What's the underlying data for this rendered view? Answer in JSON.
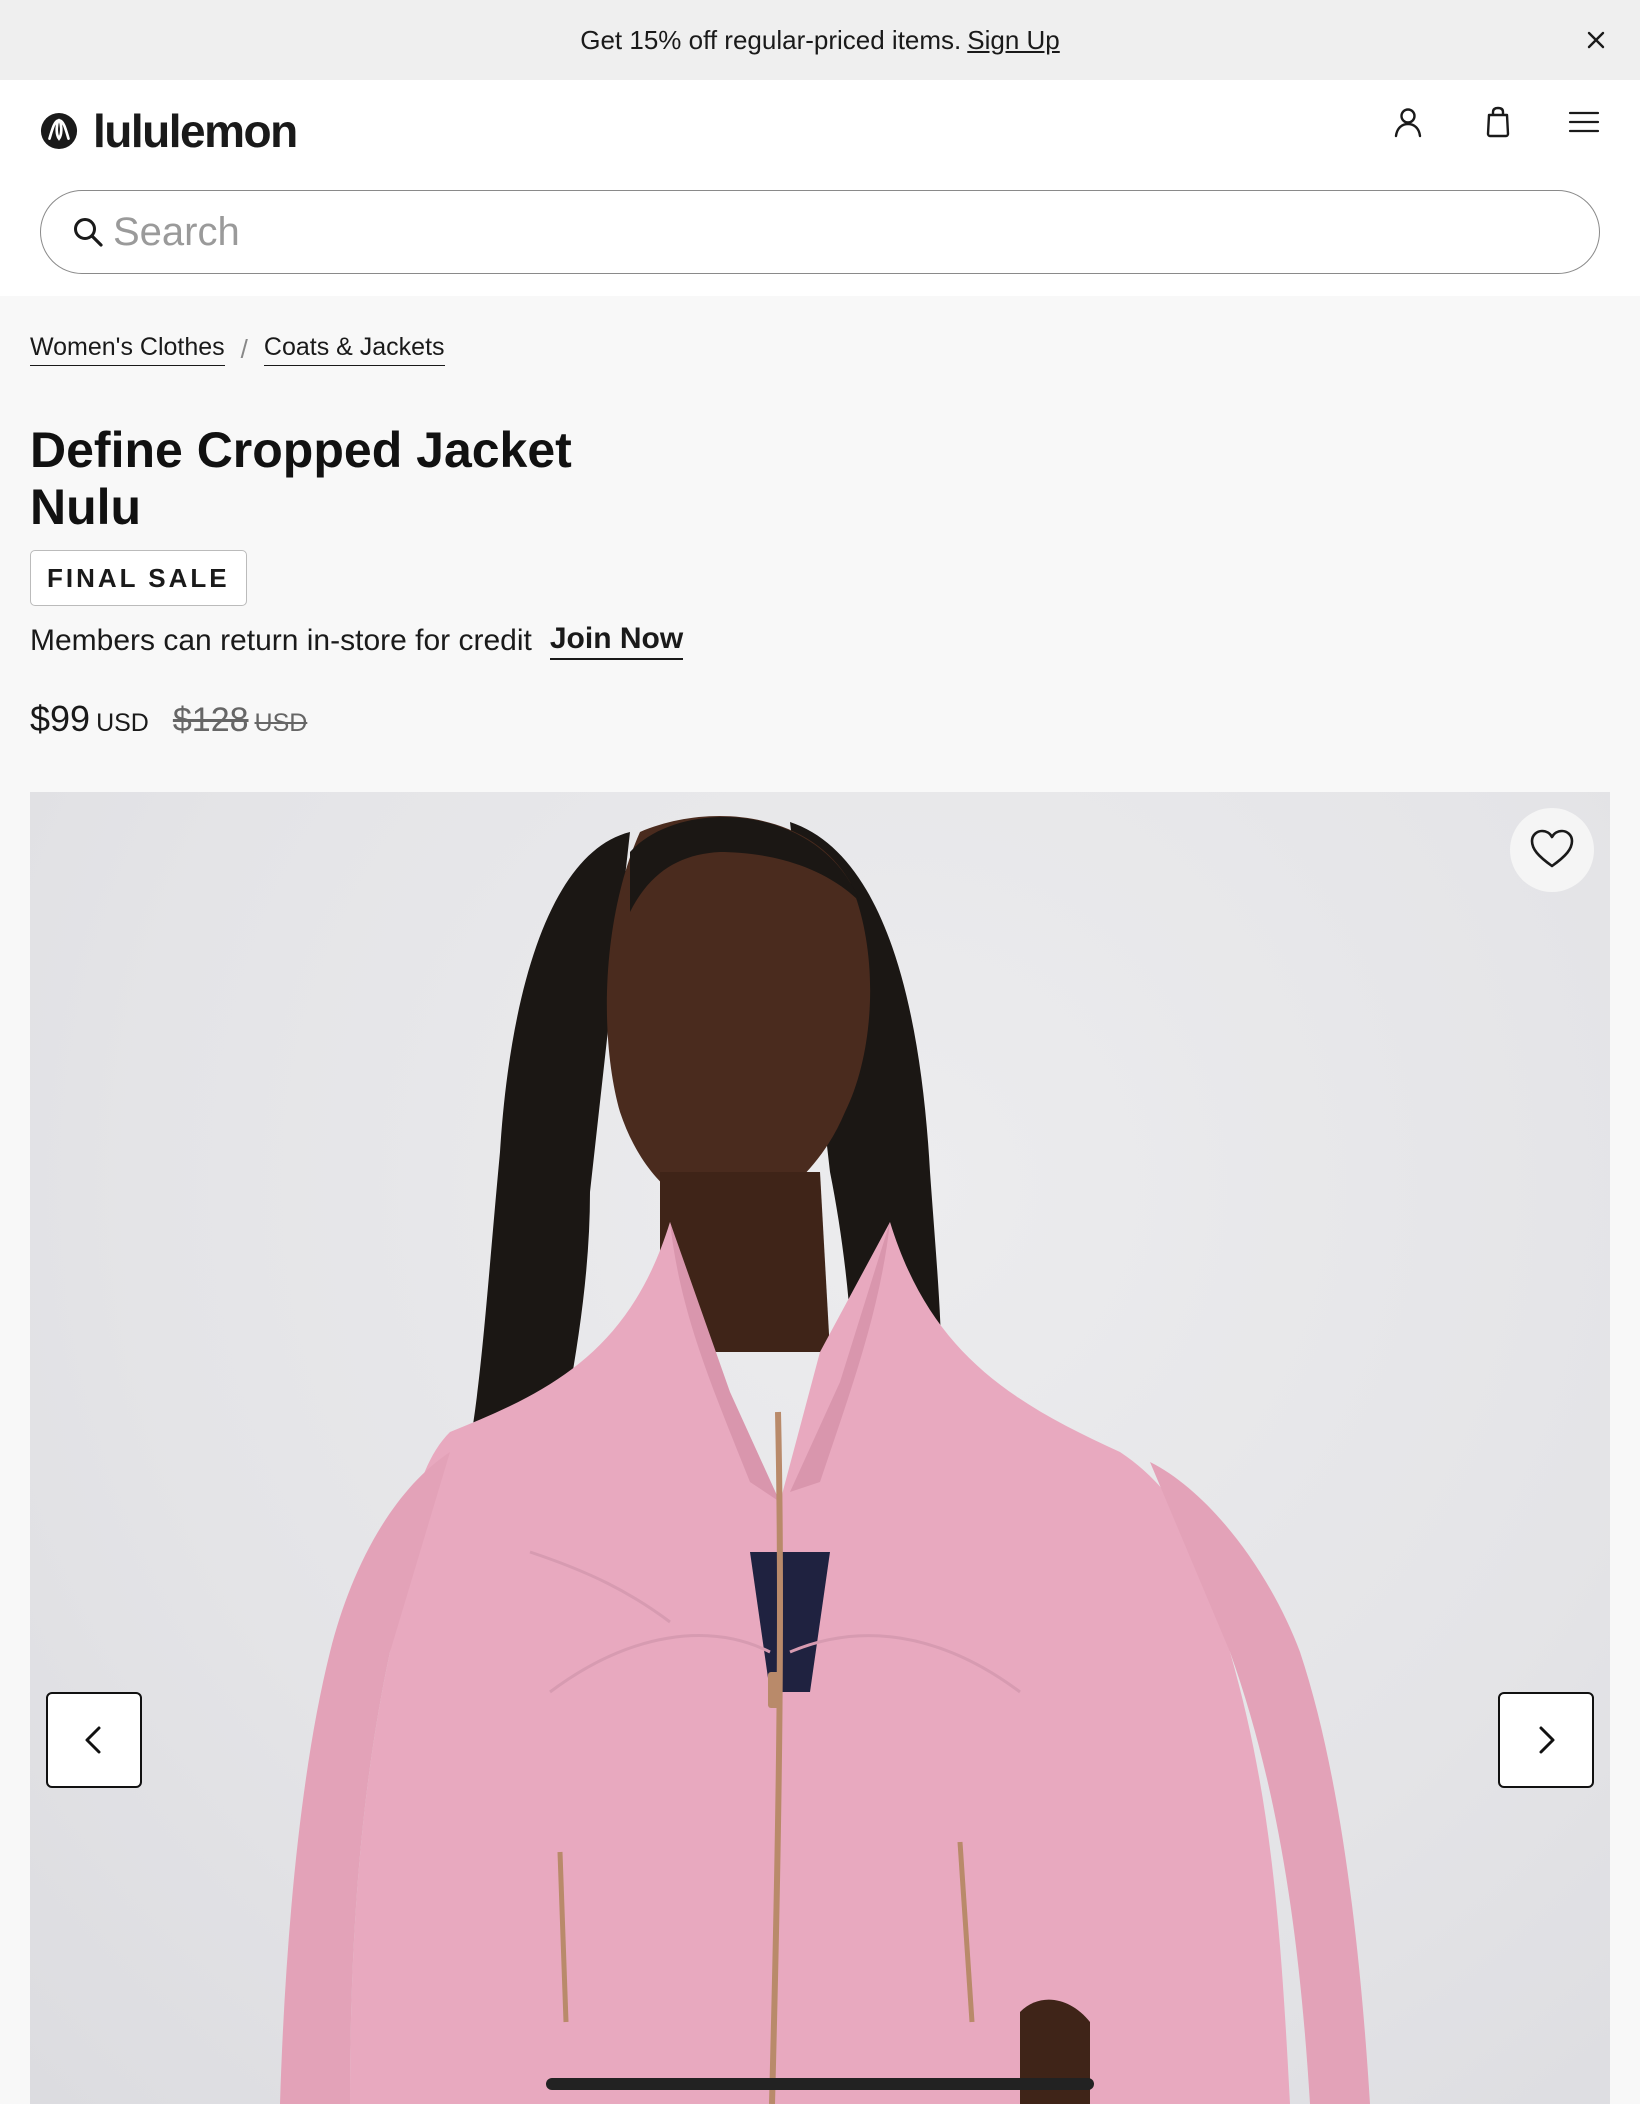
{
  "promo": {
    "text": "Get 15% off regular-priced items.",
    "link": "Sign Up",
    "close_icon": "close-icon"
  },
  "header": {
    "brand": "lululemon",
    "icons": [
      "account-icon",
      "shopping-bag-icon",
      "menu-icon"
    ]
  },
  "search": {
    "placeholder": "Search",
    "value": ""
  },
  "breadcrumb": {
    "items": [
      "Women's Clothes",
      "Coats & Jackets"
    ],
    "separator": "/"
  },
  "product": {
    "title_line1": "Define Cropped Jacket",
    "title_line2": "Nulu",
    "badge": "FINAL SALE",
    "members_text": "Members can return in-store for credit",
    "join_link": "Join Now",
    "price": "$99",
    "price_currency": "USD",
    "original_price": "$128",
    "original_currency": "USD"
  },
  "gallery": {
    "favorite_icon": "heart-icon",
    "prev_icon": "chevron-left-icon",
    "next_icon": "chevron-right-icon",
    "progress": 0.35
  },
  "colors": {
    "promo_bg": "#efefef",
    "page_bg": "#f8f8f8",
    "jacket": "#e8a9bf",
    "text": "#1a1a1a"
  }
}
